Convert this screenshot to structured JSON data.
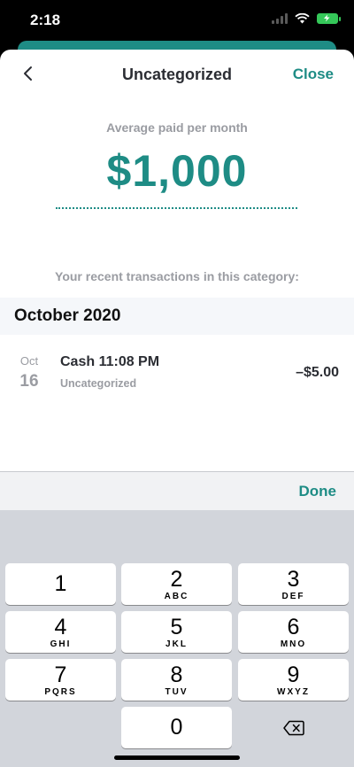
{
  "status_bar": {
    "time": "2:18"
  },
  "nav": {
    "title": "Uncategorized",
    "close_label": "Close"
  },
  "summary": {
    "label": "Average paid per month",
    "amount": "$1,000"
  },
  "recent": {
    "label": "Your recent transactions in this category:",
    "month_header": "October 2020",
    "transactions": [
      {
        "month": "Oct",
        "day": "16",
        "name": "Cash 11:08 PM",
        "category": "Uncategorized",
        "amount": "–$5.00"
      }
    ]
  },
  "keyboard": {
    "done_label": "Done",
    "keys": [
      {
        "num": "1",
        "letters": ""
      },
      {
        "num": "2",
        "letters": "ABC"
      },
      {
        "num": "3",
        "letters": "DEF"
      },
      {
        "num": "4",
        "letters": "GHI"
      },
      {
        "num": "5",
        "letters": "JKL"
      },
      {
        "num": "6",
        "letters": "MNO"
      },
      {
        "num": "7",
        "letters": "PQRS"
      },
      {
        "num": "8",
        "letters": "TUV"
      },
      {
        "num": "9",
        "letters": "WXYZ"
      },
      {
        "num": "0",
        "letters": ""
      }
    ],
    "delete_icon": "backspace-icon"
  },
  "colors": {
    "accent": "#1e8c85",
    "battery": "#35c759"
  }
}
